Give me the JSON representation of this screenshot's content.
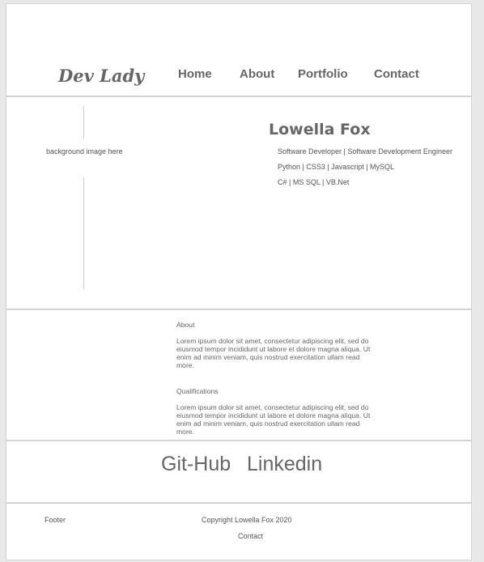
{
  "header": {
    "logo": "Dev Lady",
    "nav": [
      "Home",
      "About",
      "Portfolio",
      "Contact"
    ]
  },
  "hero": {
    "image_placeholder": "background image here",
    "name": "Lowella Fox",
    "lines": [
      "Software Developer | Software Development Engineer",
      "Python | CSS3 | Javascript | MySQL",
      "C# | MS SQL | VB.Net"
    ]
  },
  "about": {
    "heading": "About",
    "text": "Lorem ipsum dolor sit amet, consectetur adipiscing elit, sed do eiusmod tempor incididunt ut labore et dolore magna aliqua. Ut enim ad minim veniam, quis nostrud exercitation ullam read more.",
    "qual_heading": "Qualifications",
    "qual_text": "Lorem ipsum dolor sit amet, consectetur adipiscing elit, sed do eiusmod tempor incididunt ut labore et dolore magna aliqua. Ut enim ad minim veniam, quis nostrud exercitation ullam read more."
  },
  "links": {
    "github": "Git-Hub",
    "linkedin": "Linkedin"
  },
  "footer": {
    "label": "Footer",
    "copyright": "Copyright Lowella Fox 2020",
    "contact": "Contact"
  }
}
